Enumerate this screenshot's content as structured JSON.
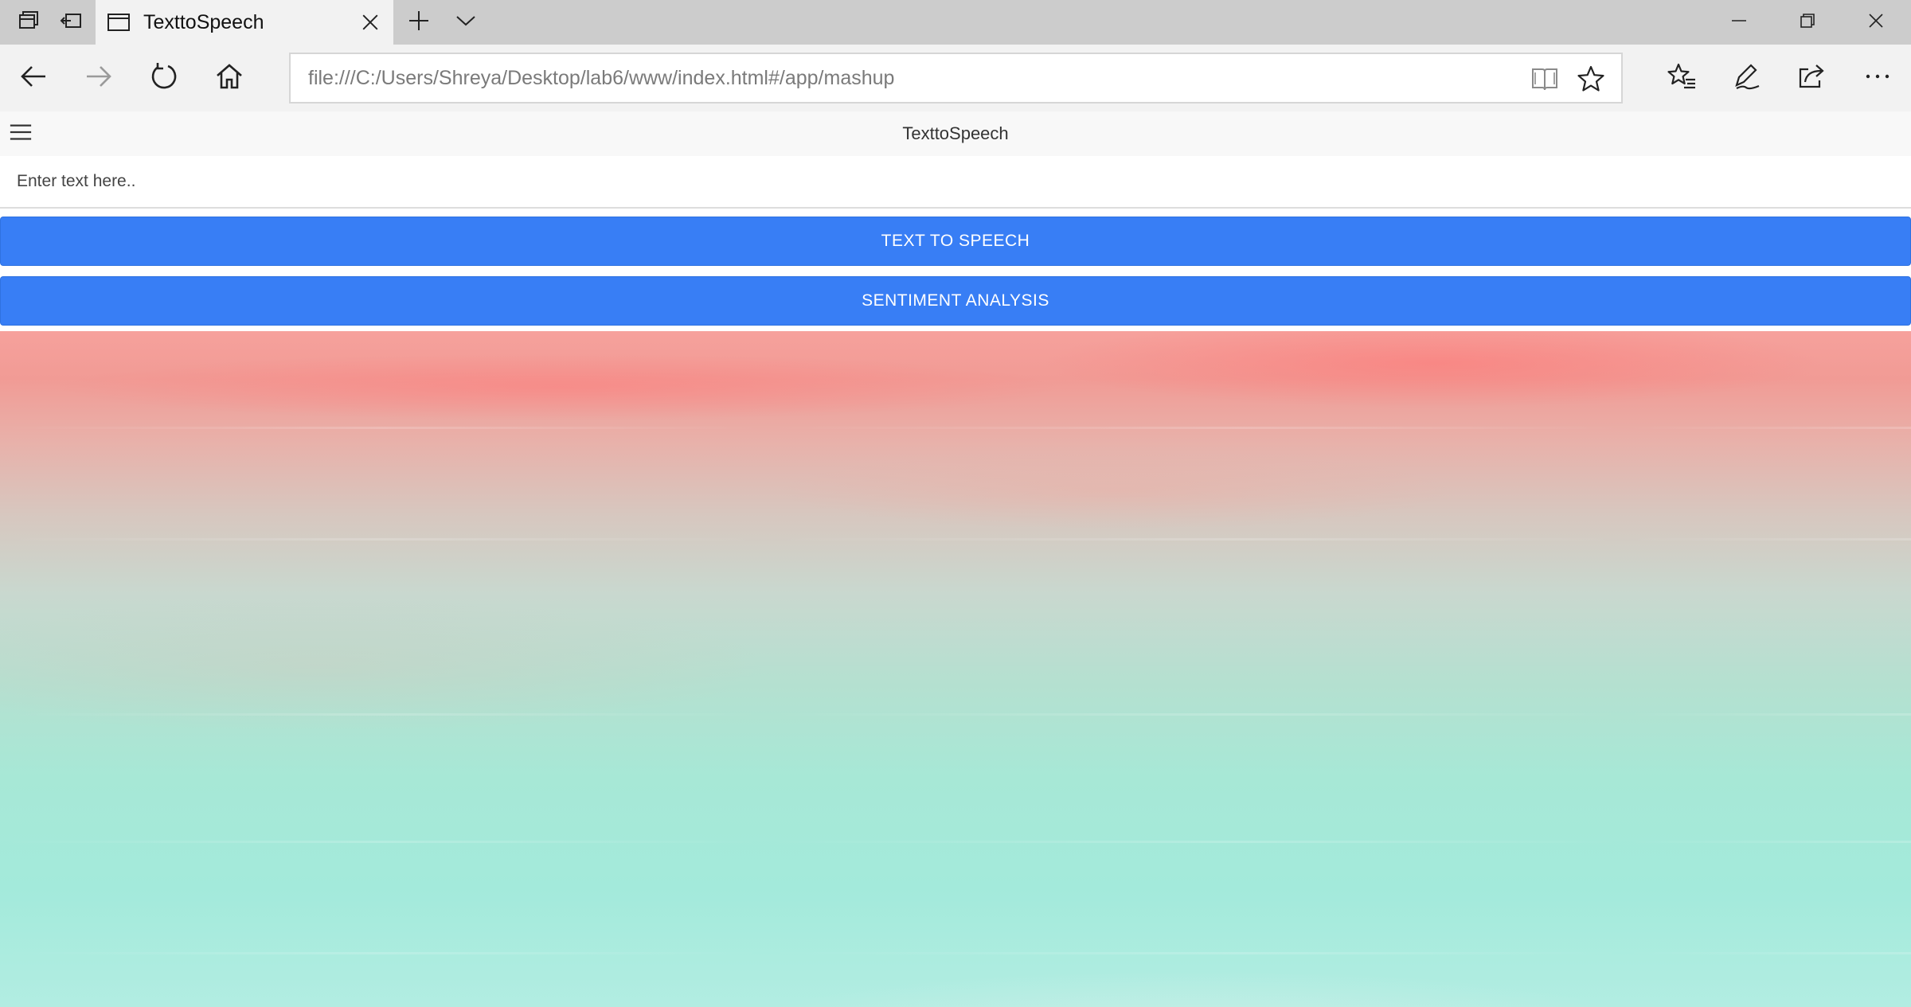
{
  "browser": {
    "tab": {
      "title": "TexttoSpeech"
    },
    "address_bar": {
      "url": "file:///C:/Users/Shreya/Desktop/lab6/www/index.html#/app/mashup"
    }
  },
  "app": {
    "header": {
      "title": "TexttoSpeech"
    },
    "input": {
      "placeholder": "Enter text here..",
      "value": ""
    },
    "buttons": {
      "text_to_speech": "TEXT TO SPEECH",
      "sentiment_analysis": "SENTIMENT ANALYSIS"
    },
    "colors": {
      "button_bg": "#387ef5",
      "button_text": "#ffffff",
      "background_top": "#f6a19c",
      "background_bottom": "#a3eadb"
    }
  },
  "icons": [
    "tab-preview-icon",
    "set-aside-tabs-icon",
    "page-icon",
    "close-icon",
    "new-tab-icon",
    "chevron-down-icon",
    "minimize-icon",
    "restore-icon",
    "window-close-icon",
    "back-arrow-icon",
    "forward-arrow-icon",
    "refresh-icon",
    "home-icon",
    "reading-view-icon",
    "favorite-star-icon",
    "favorites-hub-icon",
    "pen-icon",
    "share-icon",
    "more-icon",
    "hamburger-menu-icon"
  ]
}
